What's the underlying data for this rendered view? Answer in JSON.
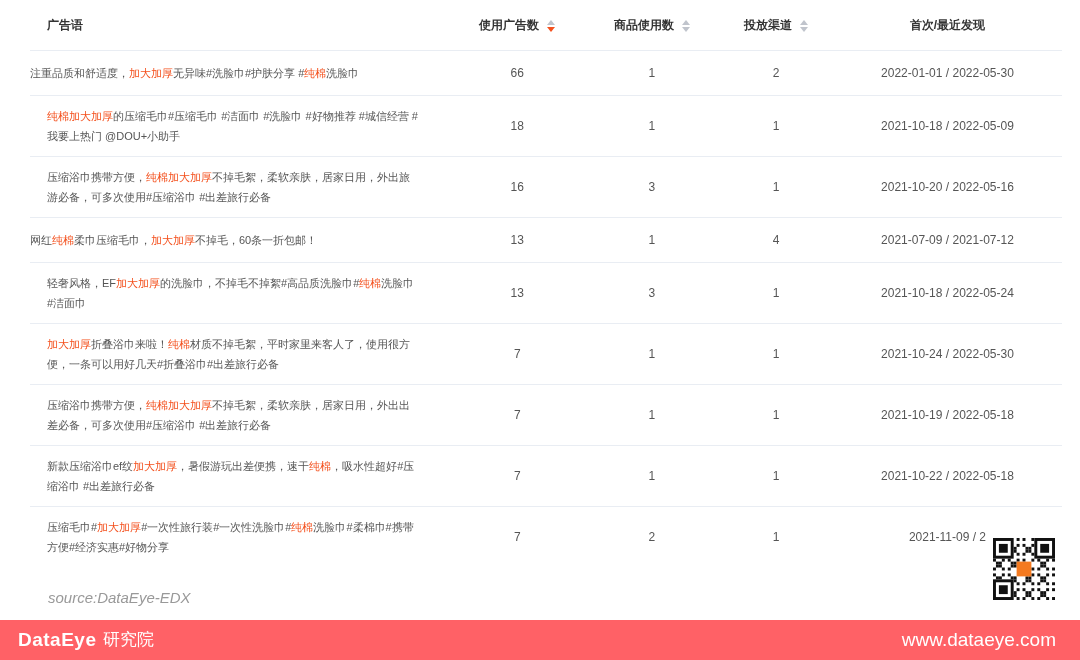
{
  "table": {
    "columns": [
      {
        "label": "广告语"
      },
      {
        "label": "使用广告数",
        "sorted": true
      },
      {
        "label": "商品使用数",
        "sorted": false
      },
      {
        "label": "投放渠道",
        "sorted": false
      },
      {
        "label": "首次/最近发现"
      }
    ],
    "rows": [
      {
        "ad_text": [
          {
            "text": "注重品质和舒适度，",
            "highlight": false
          },
          {
            "text": "加大加厚",
            "highlight": true
          },
          {
            "text": "无异味#洗脸巾#护肤分享 #",
            "highlight": false
          },
          {
            "text": "纯棉",
            "highlight": true
          },
          {
            "text": "洗脸巾",
            "highlight": false
          }
        ],
        "ads": "66",
        "products": "1",
        "channels": "2",
        "dates": "2022-01-01 / 2022-05-30"
      },
      {
        "ad_text": [
          {
            "text": "纯棉加大加厚",
            "highlight": true
          },
          {
            "text": "的压缩毛巾#压缩毛巾 #洁面巾 #洗脸巾 #好物推荐 #城信经营 #我要上热门 @DOU+小助手",
            "highlight": false
          }
        ],
        "ads": "18",
        "products": "1",
        "channels": "1",
        "dates": "2021-10-18 / 2022-05-09"
      },
      {
        "ad_text": [
          {
            "text": "压缩浴巾携带方便，",
            "highlight": false
          },
          {
            "text": "纯棉加大加厚",
            "highlight": true
          },
          {
            "text": "不掉毛絮，柔软亲肤，居家日用，外出旅游必备，可多次使用#压缩浴巾 #出差旅行必备",
            "highlight": false
          }
        ],
        "ads": "16",
        "products": "3",
        "channels": "1",
        "dates": "2021-10-20 / 2022-05-16"
      },
      {
        "ad_text": [
          {
            "text": "网红",
            "highlight": false
          },
          {
            "text": "纯棉",
            "highlight": true
          },
          {
            "text": "柔巾压缩毛巾，",
            "highlight": false
          },
          {
            "text": "加大加厚",
            "highlight": true
          },
          {
            "text": "不掉毛，60条一折包邮！",
            "highlight": false
          }
        ],
        "ads": "13",
        "products": "1",
        "channels": "4",
        "dates": "2021-07-09 / 2021-07-12"
      },
      {
        "ad_text": [
          {
            "text": "轻奢风格，EF",
            "highlight": false
          },
          {
            "text": "加大加厚",
            "highlight": true
          },
          {
            "text": "的洗脸巾，不掉毛不掉絮#高品质洗脸巾#",
            "highlight": false
          },
          {
            "text": "纯棉",
            "highlight": true
          },
          {
            "text": "洗脸巾 #洁面巾",
            "highlight": false
          }
        ],
        "ads": "13",
        "products": "3",
        "channels": "1",
        "dates": "2021-10-18 / 2022-05-24"
      },
      {
        "ad_text": [
          {
            "text": "加大加厚",
            "highlight": true
          },
          {
            "text": "折叠浴巾来啦！",
            "highlight": false
          },
          {
            "text": "纯棉",
            "highlight": true
          },
          {
            "text": "材质不掉毛絮，平时家里来客人了，使用很方便，一条可以用好几天#折叠浴巾#出差旅行必备",
            "highlight": false
          }
        ],
        "ads": "7",
        "products": "1",
        "channels": "1",
        "dates": "2021-10-24 / 2022-05-30"
      },
      {
        "ad_text": [
          {
            "text": "压缩浴巾携带方便，",
            "highlight": false
          },
          {
            "text": "纯棉加大加厚",
            "highlight": true
          },
          {
            "text": "不掉毛絮，柔软亲肤，居家日用，外出出差必备，可多次使用#压缩浴巾 #出差旅行必备",
            "highlight": false
          }
        ],
        "ads": "7",
        "products": "1",
        "channels": "1",
        "dates": "2021-10-19 / 2022-05-18"
      },
      {
        "ad_text": [
          {
            "text": "新款压缩浴巾ef纹",
            "highlight": false
          },
          {
            "text": "加大加厚",
            "highlight": true
          },
          {
            "text": "，暑假游玩出差便携，速干",
            "highlight": false
          },
          {
            "text": "纯棉",
            "highlight": true
          },
          {
            "text": "，吸水性超好#压缩浴巾 #出差旅行必备",
            "highlight": false
          }
        ],
        "ads": "7",
        "products": "1",
        "channels": "1",
        "dates": "2021-10-22 / 2022-05-18"
      },
      {
        "ad_text": [
          {
            "text": "压缩毛巾#",
            "highlight": false
          },
          {
            "text": "加大加厚",
            "highlight": true
          },
          {
            "text": "#一次性旅行装#一次性洗脸巾#",
            "highlight": false
          },
          {
            "text": "纯棉",
            "highlight": true
          },
          {
            "text": "洗脸巾#柔棉巾#携带方便#经济实惠#好物分享",
            "highlight": false
          }
        ],
        "ads": "7",
        "products": "2",
        "channels": "1",
        "dates": "2021-11-09 / 2"
      }
    ]
  },
  "source": "source:DataEye-EDX",
  "footer": {
    "brand": "DataEye",
    "brand_suffix": "研究院",
    "website": "www.dataeye.com"
  }
}
